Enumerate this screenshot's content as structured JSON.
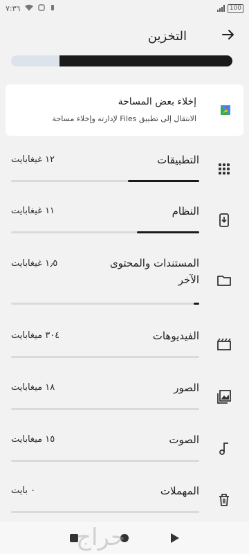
{
  "status_bar": {
    "time": "٧:٣٦",
    "battery": "100"
  },
  "header": {
    "title": "التخزين",
    "back_icon": "arrow-right-icon"
  },
  "usage": {
    "used_fraction": 0.78,
    "fill_color": "#1a1a1a",
    "track_color": "#dde3ea"
  },
  "free_up_card": {
    "title": "إخلاء بعض المساحة",
    "subtitle": "الانتقال إلى تطبيق Files لإدارته وإخلاء مساحة",
    "icon": "files-app-icon"
  },
  "categories": [
    {
      "label": "التطبيقات",
      "size": "١٢ غيغابايت",
      "fraction": 0.38,
      "icon": "apps-grid-icon"
    },
    {
      "label": "النظام",
      "size": "١١ غيغابايت",
      "fraction": 0.33,
      "icon": "system-phone-icon"
    },
    {
      "label": "المستندات والمحتوى الآخر",
      "size": "١٫٥ غيغابايت",
      "fraction": 0.03,
      "icon": "folder-icon"
    },
    {
      "label": "الفيديوهات",
      "size": "٣٠٤ ميغابايت",
      "fraction": 0.0,
      "icon": "video-icon"
    },
    {
      "label": "الصور",
      "size": "١٨ ميغابايت",
      "fraction": 0.0,
      "icon": "image-icon"
    },
    {
      "label": "الصوت",
      "size": "١٥ ميغابايت",
      "fraction": 0.0,
      "icon": "music-note-icon"
    },
    {
      "label": "المهملات",
      "size": "٠ بايت",
      "fraction": 0.0,
      "icon": "trash-icon"
    }
  ],
  "navigation": {
    "recents_icon": "square-icon",
    "home_icon": "circle-icon",
    "back_icon": "triangle-back-icon"
  },
  "watermark": {
    "text": "حراج"
  }
}
